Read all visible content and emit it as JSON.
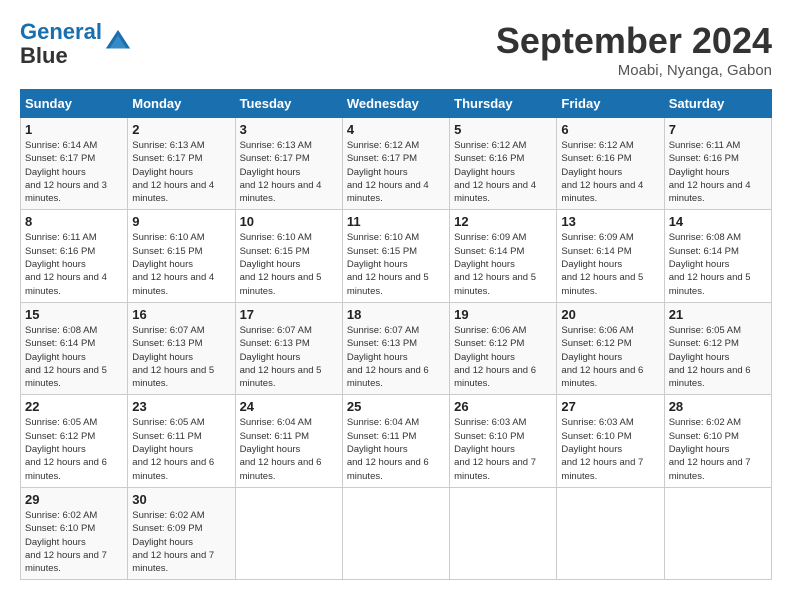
{
  "header": {
    "logo_line1": "General",
    "logo_line2": "Blue",
    "month": "September 2024",
    "location": "Moabi, Nyanga, Gabon"
  },
  "weekdays": [
    "Sunday",
    "Monday",
    "Tuesday",
    "Wednesday",
    "Thursday",
    "Friday",
    "Saturday"
  ],
  "weeks": [
    [
      {
        "day": "1",
        "sunrise": "6:14 AM",
        "sunset": "6:17 PM",
        "daylight": "12 hours and 3 minutes."
      },
      {
        "day": "2",
        "sunrise": "6:13 AM",
        "sunset": "6:17 PM",
        "daylight": "12 hours and 4 minutes."
      },
      {
        "day": "3",
        "sunrise": "6:13 AM",
        "sunset": "6:17 PM",
        "daylight": "12 hours and 4 minutes."
      },
      {
        "day": "4",
        "sunrise": "6:12 AM",
        "sunset": "6:17 PM",
        "daylight": "12 hours and 4 minutes."
      },
      {
        "day": "5",
        "sunrise": "6:12 AM",
        "sunset": "6:16 PM",
        "daylight": "12 hours and 4 minutes."
      },
      {
        "day": "6",
        "sunrise": "6:12 AM",
        "sunset": "6:16 PM",
        "daylight": "12 hours and 4 minutes."
      },
      {
        "day": "7",
        "sunrise": "6:11 AM",
        "sunset": "6:16 PM",
        "daylight": "12 hours and 4 minutes."
      }
    ],
    [
      {
        "day": "8",
        "sunrise": "6:11 AM",
        "sunset": "6:16 PM",
        "daylight": "12 hours and 4 minutes."
      },
      {
        "day": "9",
        "sunrise": "6:10 AM",
        "sunset": "6:15 PM",
        "daylight": "12 hours and 4 minutes."
      },
      {
        "day": "10",
        "sunrise": "6:10 AM",
        "sunset": "6:15 PM",
        "daylight": "12 hours and 5 minutes."
      },
      {
        "day": "11",
        "sunrise": "6:10 AM",
        "sunset": "6:15 PM",
        "daylight": "12 hours and 5 minutes."
      },
      {
        "day": "12",
        "sunrise": "6:09 AM",
        "sunset": "6:14 PM",
        "daylight": "12 hours and 5 minutes."
      },
      {
        "day": "13",
        "sunrise": "6:09 AM",
        "sunset": "6:14 PM",
        "daylight": "12 hours and 5 minutes."
      },
      {
        "day": "14",
        "sunrise": "6:08 AM",
        "sunset": "6:14 PM",
        "daylight": "12 hours and 5 minutes."
      }
    ],
    [
      {
        "day": "15",
        "sunrise": "6:08 AM",
        "sunset": "6:14 PM",
        "daylight": "12 hours and 5 minutes."
      },
      {
        "day": "16",
        "sunrise": "6:07 AM",
        "sunset": "6:13 PM",
        "daylight": "12 hours and 5 minutes."
      },
      {
        "day": "17",
        "sunrise": "6:07 AM",
        "sunset": "6:13 PM",
        "daylight": "12 hours and 5 minutes."
      },
      {
        "day": "18",
        "sunrise": "6:07 AM",
        "sunset": "6:13 PM",
        "daylight": "12 hours and 6 minutes."
      },
      {
        "day": "19",
        "sunrise": "6:06 AM",
        "sunset": "6:12 PM",
        "daylight": "12 hours and 6 minutes."
      },
      {
        "day": "20",
        "sunrise": "6:06 AM",
        "sunset": "6:12 PM",
        "daylight": "12 hours and 6 minutes."
      },
      {
        "day": "21",
        "sunrise": "6:05 AM",
        "sunset": "6:12 PM",
        "daylight": "12 hours and 6 minutes."
      }
    ],
    [
      {
        "day": "22",
        "sunrise": "6:05 AM",
        "sunset": "6:12 PM",
        "daylight": "12 hours and 6 minutes."
      },
      {
        "day": "23",
        "sunrise": "6:05 AM",
        "sunset": "6:11 PM",
        "daylight": "12 hours and 6 minutes."
      },
      {
        "day": "24",
        "sunrise": "6:04 AM",
        "sunset": "6:11 PM",
        "daylight": "12 hours and 6 minutes."
      },
      {
        "day": "25",
        "sunrise": "6:04 AM",
        "sunset": "6:11 PM",
        "daylight": "12 hours and 6 minutes."
      },
      {
        "day": "26",
        "sunrise": "6:03 AM",
        "sunset": "6:10 PM",
        "daylight": "12 hours and 7 minutes."
      },
      {
        "day": "27",
        "sunrise": "6:03 AM",
        "sunset": "6:10 PM",
        "daylight": "12 hours and 7 minutes."
      },
      {
        "day": "28",
        "sunrise": "6:02 AM",
        "sunset": "6:10 PM",
        "daylight": "12 hours and 7 minutes."
      }
    ],
    [
      {
        "day": "29",
        "sunrise": "6:02 AM",
        "sunset": "6:10 PM",
        "daylight": "12 hours and 7 minutes."
      },
      {
        "day": "30",
        "sunrise": "6:02 AM",
        "sunset": "6:09 PM",
        "daylight": "12 hours and 7 minutes."
      },
      null,
      null,
      null,
      null,
      null
    ]
  ]
}
